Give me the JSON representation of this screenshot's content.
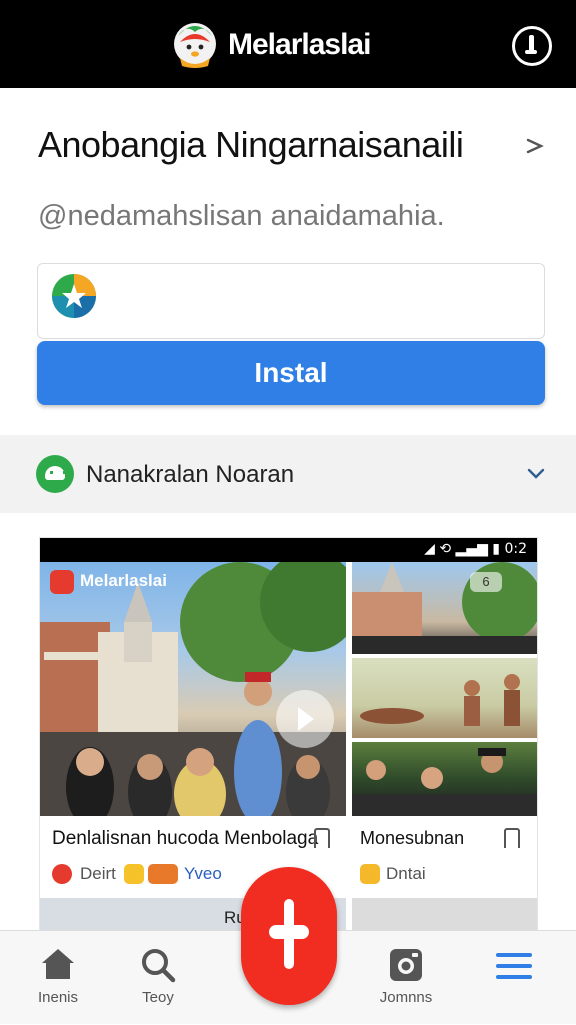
{
  "app": {
    "title": "Melarlaslai"
  },
  "header": {
    "title": "Anobangia Ningarnaisanaili",
    "handle": "@nedamahslisan anaidamahia."
  },
  "install": {
    "label": "Instal"
  },
  "notice": {
    "label": "Nanakralan Noaran"
  },
  "preview": {
    "status": "◢ ⟲ ▂▄▆ ▮ 0:2",
    "overlay_label": "Melarlaslai",
    "overlay_badge": "6",
    "card1": {
      "title": "Denlalisnan hucoda Menbolaga",
      "meta1": "Deirt",
      "meta2": "Yveo"
    },
    "card2": {
      "title": "Monesubnan",
      "meta": "Dntai"
    },
    "card_bottom": {
      "title": "Runja"
    }
  },
  "nav": {
    "home": "Inenis",
    "search": "Teoy",
    "gallery": "Jomnns",
    "menu": ""
  },
  "colors": {
    "accent": "#2f7fe6",
    "fab": "#f02d20",
    "green": "#2eaa4a"
  },
  "icons": [
    "app-logo-icon",
    "power-icon",
    "chevron-down-icon",
    "android-icon",
    "bookmark-icon",
    "home-icon",
    "search-icon",
    "camera-icon",
    "menu-icon",
    "play-icon"
  ]
}
